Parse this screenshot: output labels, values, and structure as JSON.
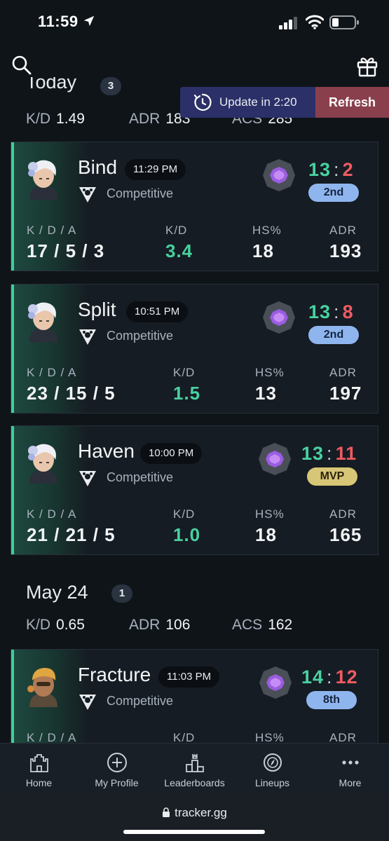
{
  "status_bar": {
    "time": "11:59"
  },
  "update_banner": {
    "text": "Update in 2:20",
    "refresh_label": "Refresh"
  },
  "groups": [
    {
      "date": "Today",
      "count": "3",
      "summary": {
        "kd_label": "K/D",
        "kd": "1.49",
        "adr_label": "ADR",
        "adr": "183",
        "acs_label": "ACS",
        "acs": "285"
      }
    },
    {
      "date": "May 24",
      "count": "1",
      "summary": {
        "kd_label": "K/D",
        "kd": "0.65",
        "adr_label": "ADR",
        "adr": "106",
        "acs_label": "ACS",
        "acs": "162"
      }
    }
  ],
  "stat_labels": {
    "kda": "K / D / A",
    "kd": "K/D",
    "hs": "HS%",
    "adr": "ADR"
  },
  "matches": [
    {
      "map": "Bind",
      "time": "11:29 PM",
      "mode": "Competitive",
      "score_won": "13",
      "score_lost": "2",
      "placement": "2nd",
      "kda": "17 / 5 / 3",
      "kd": "3.4",
      "hs": "18",
      "adr": "193"
    },
    {
      "map": "Split",
      "time": "10:51 PM",
      "mode": "Competitive",
      "score_won": "13",
      "score_lost": "8",
      "placement": "2nd",
      "kda": "23 / 15 / 5",
      "kd": "1.5",
      "hs": "13",
      "adr": "197"
    },
    {
      "map": "Haven",
      "time": "10:00 PM",
      "mode": "Competitive",
      "score_won": "13",
      "score_lost": "11",
      "placement": "MVP",
      "kda": "21 / 21 / 5",
      "kd": "1.0",
      "hs": "18",
      "adr": "165"
    },
    {
      "map": "Fracture",
      "time": "11:03 PM",
      "mode": "Competitive",
      "score_won": "14",
      "score_lost": "12",
      "placement": "8th",
      "kda": "",
      "kd": "",
      "hs": "",
      "adr": ""
    }
  ],
  "bottom_nav": [
    {
      "label": "Home",
      "icon": "castle-icon"
    },
    {
      "label": "My Profile",
      "icon": "plus-circle-icon"
    },
    {
      "label": "Leaderboards",
      "icon": "podium-icon"
    },
    {
      "label": "Lineups",
      "icon": "compass-icon"
    },
    {
      "label": "More",
      "icon": "more-dots-icon"
    }
  ],
  "browser": {
    "url": "tracker.gg"
  },
  "colors": {
    "win": "#48d1a0",
    "loss": "#ef5a62",
    "accent": "#3fcf9a",
    "refresh": "#8a3f4c",
    "update": "#2b3068"
  }
}
